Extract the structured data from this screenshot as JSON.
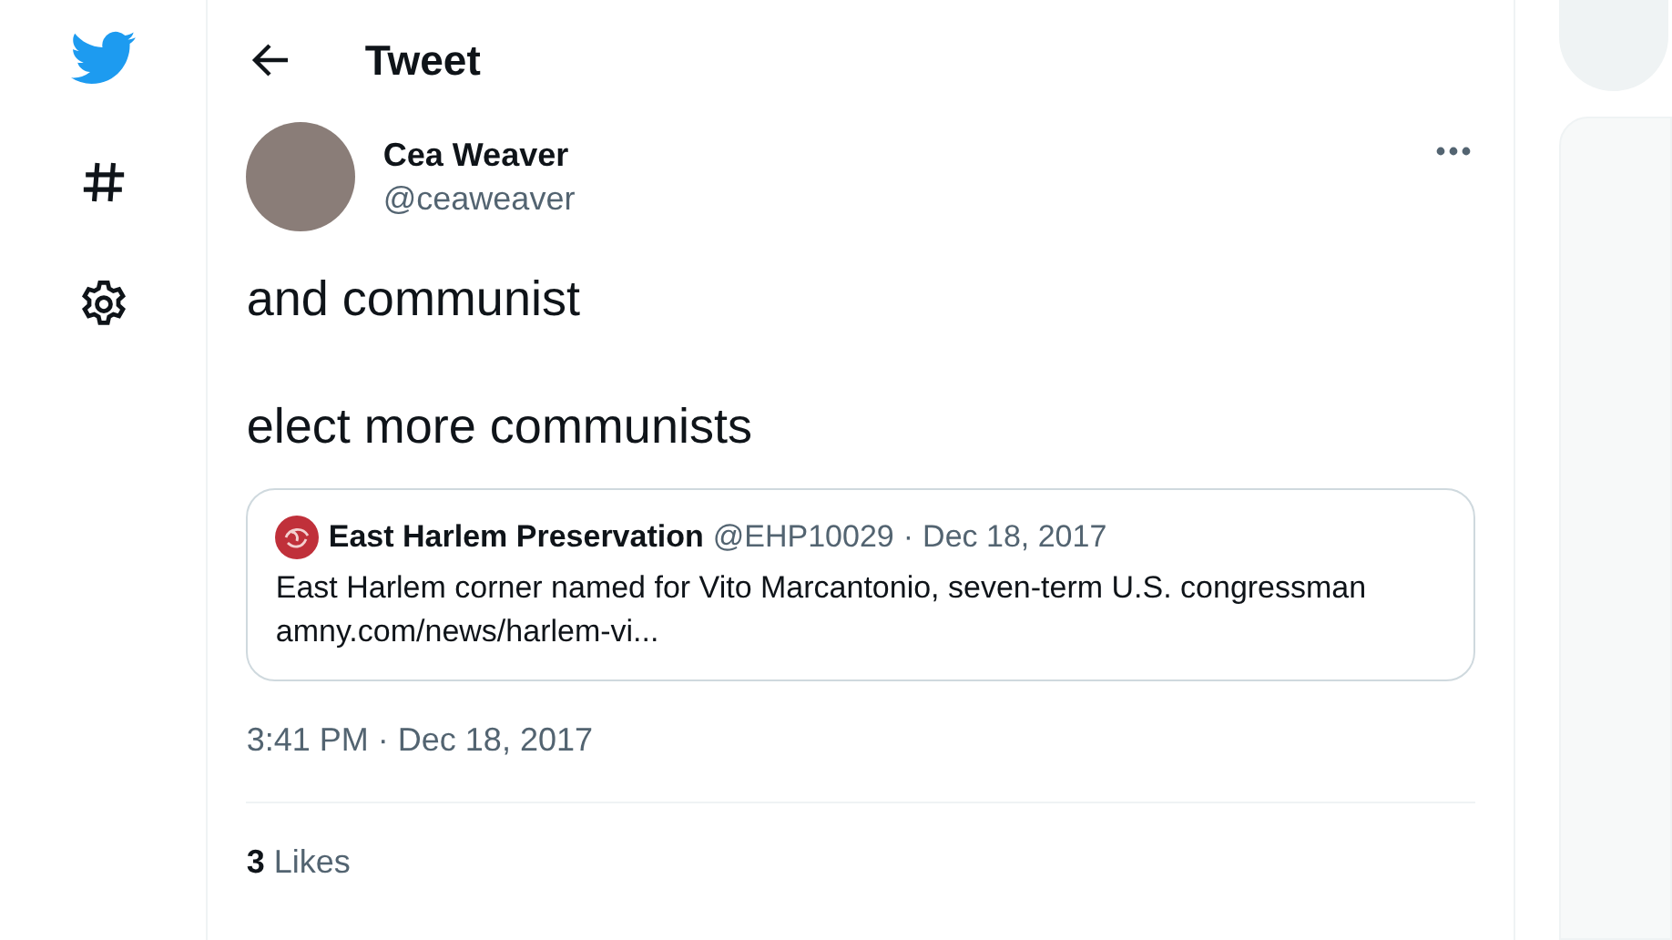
{
  "header": {
    "title": "Tweet"
  },
  "tweet": {
    "author": {
      "name": "Cea Weaver",
      "handle": "@ceaweaver"
    },
    "paragraphs": [
      "and communist",
      "elect more communists"
    ],
    "quote": {
      "author": "East Harlem Preservation",
      "handle": "@EHP10029",
      "separator": "·",
      "date": "Dec 18, 2017",
      "text": "East Harlem corner named for Vito Marcantonio, seven-term U.S. congressman",
      "link": "amny.com/news/harlem-vi..."
    },
    "timestamp": "3:41 PM · Dec 18, 2017",
    "likes": {
      "count": "3",
      "label": "Likes"
    }
  }
}
